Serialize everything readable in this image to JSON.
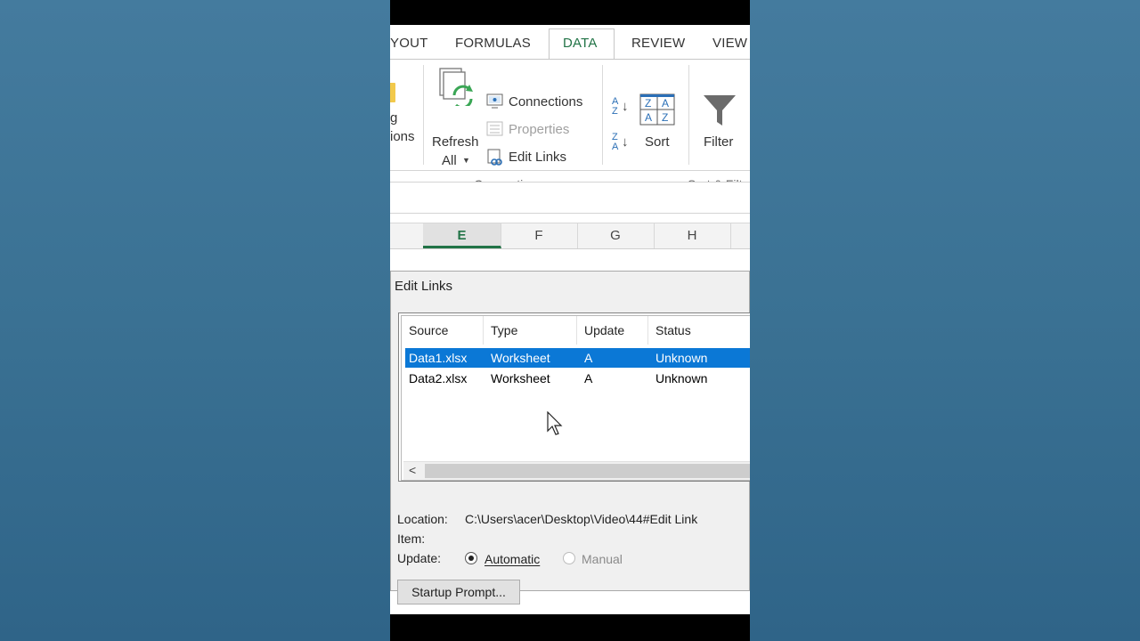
{
  "ribbon": {
    "tabs": [
      {
        "label": "YOUT",
        "active": false
      },
      {
        "label": "FORMULAS",
        "active": false
      },
      {
        "label": "DATA",
        "active": true
      },
      {
        "label": "REVIEW",
        "active": false
      },
      {
        "label": "VIEW",
        "active": false
      }
    ],
    "partial_left": {
      "line1": "g",
      "line2": "ions"
    },
    "refresh": {
      "line1": "Refresh",
      "line2": "All"
    },
    "connections_items": [
      {
        "label": "Connections",
        "enabled": true
      },
      {
        "label": "Properties",
        "enabled": false
      },
      {
        "label": "Edit Links",
        "enabled": true
      }
    ],
    "connections_group": "Connections",
    "sort_label": "Sort",
    "filter_label": "Filter",
    "sort_filter_group": "Sort & Filt",
    "sort_asc_glyph": "A↓Z",
    "sort_desc_glyph": "Z↓A",
    "sort_icon_letters": [
      "Z",
      "A",
      "A",
      "Z"
    ]
  },
  "columns": [
    "E",
    "F",
    "G",
    "H"
  ],
  "selected_column": "E",
  "dialog": {
    "title": "Edit Links",
    "list_headers": [
      "Source",
      "Type",
      "Update",
      "Status"
    ],
    "rows": [
      {
        "source": "Data1.xlsx",
        "type": "Worksheet",
        "update": "A",
        "status": "Unknown",
        "selected": true
      },
      {
        "source": "Data2.xlsx",
        "type": "Worksheet",
        "update": "A",
        "status": "Unknown",
        "selected": false
      }
    ],
    "location_label": "Location:",
    "location_value": "C:\\Users\\acer\\Desktop\\Video\\44#Edit Link",
    "item_label": "Item:",
    "update_label": "Update:",
    "automatic_label": "Automatic",
    "manual_label": "Manual",
    "update_mode": "Automatic",
    "startup_button": "Startup Prompt..."
  },
  "colors": {
    "accent": "#217346",
    "selection": "#0b78d6",
    "background": "#3d7396"
  }
}
